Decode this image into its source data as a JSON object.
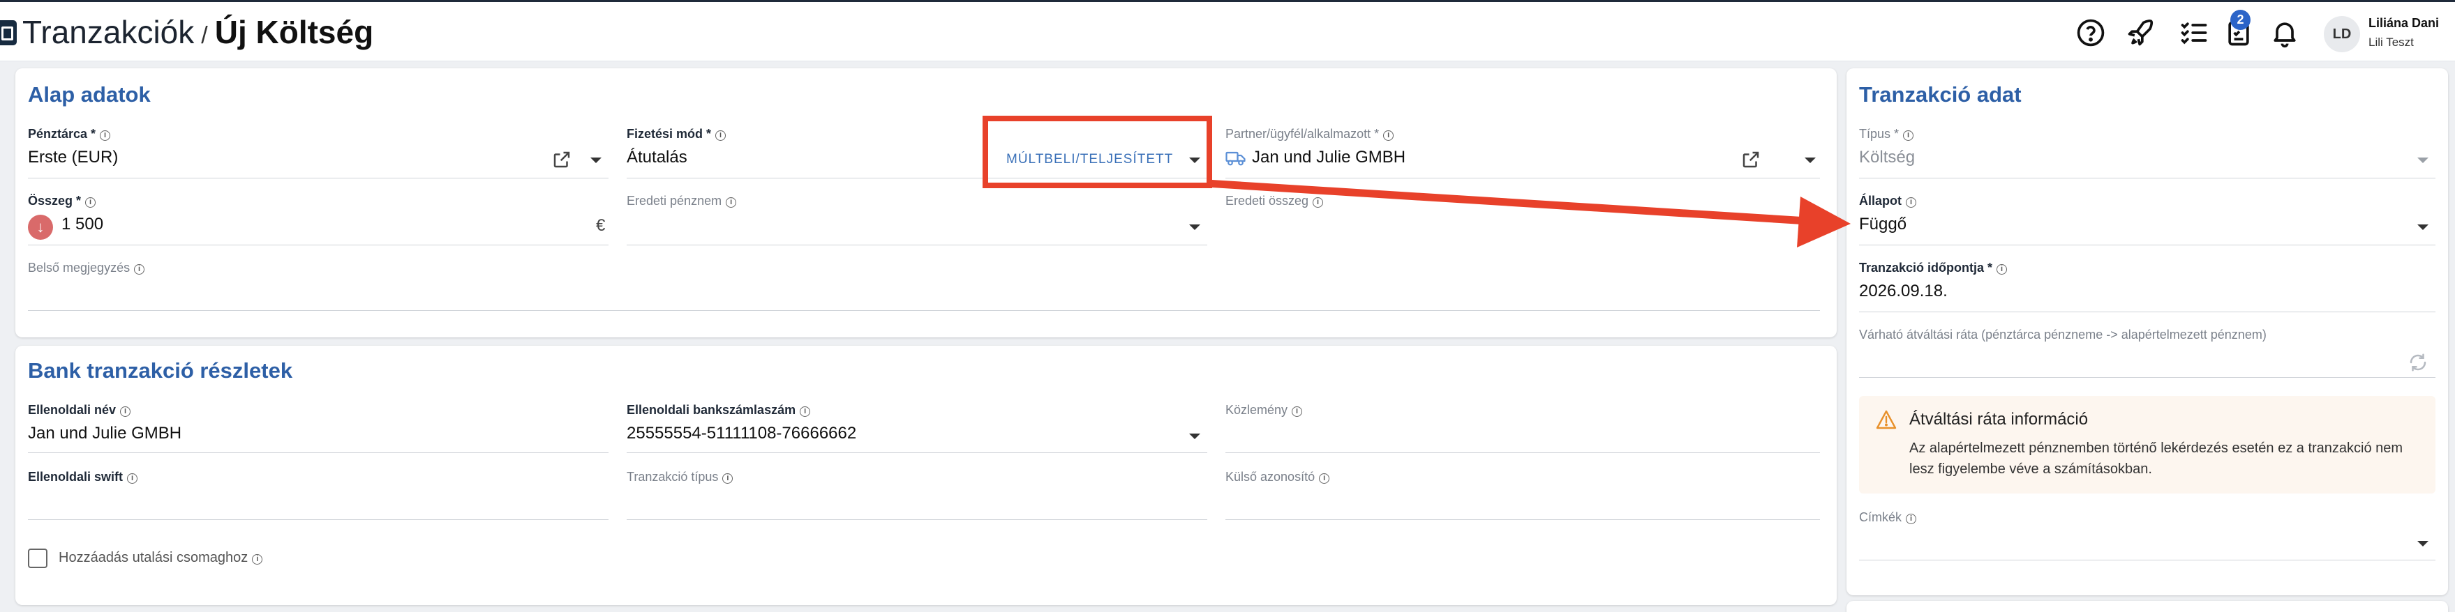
{
  "header": {
    "crumb": "Tranzakciók",
    "separator": "/",
    "title": "Új Költség",
    "task_badge": "2",
    "user_initials": "LD",
    "user_name": "Liliána Dani",
    "user_org": "Lili Teszt"
  },
  "alap_adatok": {
    "title": "Alap adatok",
    "penztarca_label": "Pénztárca *",
    "penztarca_value": "Erste (EUR)",
    "fizetesi_mod_label": "Fizetési mód *",
    "fizetesi_mod_value": "Átutalás",
    "fizetesi_mod_tag": "MÚLTBELI/TELJESÍTETT",
    "partner_label": "Partner/ügyfél/alkalmazott *",
    "partner_value": "Jan und Julie GMBH",
    "osszeg_label": "Összeg *",
    "osszeg_value": "1 500",
    "currency_symbol": "€",
    "eredeti_penznem_label": "Eredeti pénznem",
    "eredeti_osszeg_label": "Eredeti összeg",
    "belso_megjegyzes_label": "Belső megjegyzés"
  },
  "bank_reszletek": {
    "title": "Bank tranzakció részletek",
    "ellenoldali_nev_label": "Ellenoldali név",
    "ellenoldali_nev_value": "Jan und Julie GMBH",
    "bankszamlaszam_label": "Ellenoldali bankszámlaszám",
    "bankszamlaszam_value": "25555554-51111108-76666662",
    "kozlemeny_label": "Közlemény",
    "swift_label": "Ellenoldali swift",
    "tranzakcio_tipus_label": "Tranzakció típus",
    "kulso_azonosito_label": "Külső azonosító",
    "csomag_label": "Hozzáadás utalási csomaghoz"
  },
  "tranzakcio_adat": {
    "title": "Tranzakció adat",
    "tipus_label": "Típus *",
    "tipus_value": "Költség",
    "allapot_label": "Állapot",
    "allapot_value": "Függő",
    "idopont_label": "Tranzakció időpontja *",
    "idopont_value": "2026.09.18.",
    "rata_label": "Várható átváltási ráta (pénztárca pénzneme -> alapértelmezett pénznem)",
    "warn_title": "Átváltási ráta információ",
    "warn_text": "Az alapértelmezett pénznemben történő lekérdezés esetén ez a tranzakció nem lesz figyelembe véve a számításokban.",
    "cimkek_label": "Címkék"
  },
  "colors": {
    "accent_blue": "#2d5fa6",
    "highlight_red": "#e8412a",
    "warning_orange": "#e8902a"
  }
}
